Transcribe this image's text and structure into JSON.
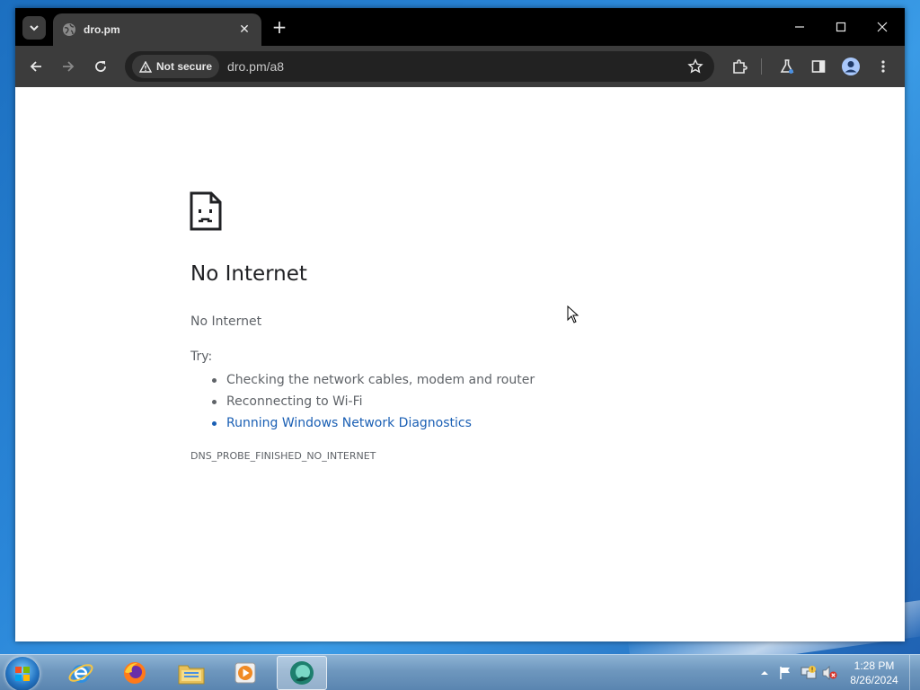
{
  "browser": {
    "tab": {
      "title": "dro.pm"
    },
    "omnibox": {
      "security_label": "Not secure",
      "url": "dro.pm/a8"
    }
  },
  "page": {
    "title": "No Internet",
    "subtitle": "No Internet",
    "try_label": "Try:",
    "suggestions": [
      "Checking the network cables, modem and router",
      "Reconnecting to Wi-Fi",
      "Running Windows Network Diagnostics"
    ],
    "error_code": "DNS_PROBE_FINISHED_NO_INTERNET"
  },
  "taskbar": {
    "apps": [
      "internet-explorer",
      "firefox",
      "file-explorer",
      "media-player",
      "chrome-like-browser"
    ],
    "clock": {
      "time": "1:28 PM",
      "date": "8/26/2024"
    }
  },
  "colors": {
    "tabstrip": "#000000",
    "toolbar": "#3c3c3c",
    "link": "#1a5fb4",
    "text": "#5f6368"
  }
}
